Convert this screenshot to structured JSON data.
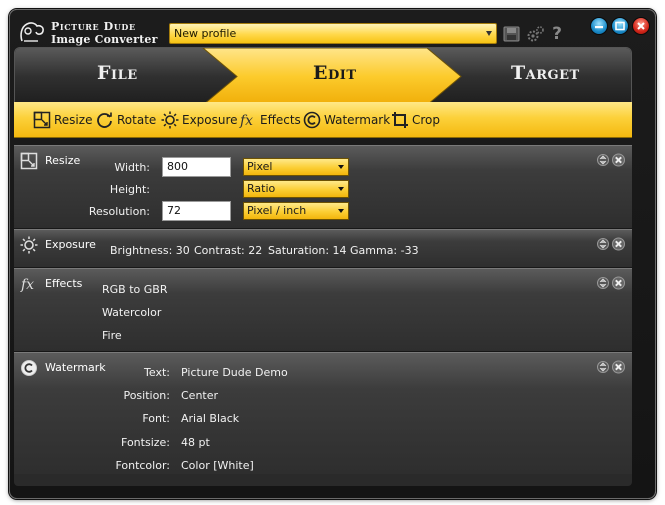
{
  "app": {
    "logo_line1": "Picture Dude",
    "logo_line2": "Image Converter",
    "profile": "New profile"
  },
  "steps": {
    "file": "File",
    "edit": "Edit",
    "target": "Target",
    "active": "edit"
  },
  "tools": [
    {
      "label": "Resize",
      "icon": "resize-icon"
    },
    {
      "label": "Rotate",
      "icon": "rotate-icon"
    },
    {
      "label": "Exposure",
      "icon": "exposure-icon"
    },
    {
      "label": "Effects",
      "icon": "effects-icon"
    },
    {
      "label": "Watermark",
      "icon": "watermark-icon"
    },
    {
      "label": "Crop",
      "icon": "crop-icon"
    }
  ],
  "resize": {
    "title": "Resize",
    "width_label": "Width:",
    "width_value": "800",
    "width_unit": "Pixel",
    "height_label": "Height:",
    "height_unit": "Ratio",
    "resolution_label": "Resolution:",
    "resolution_value": "72",
    "resolution_unit": "Pixel / inch"
  },
  "exposure": {
    "title": "Exposure",
    "brightness": "Brightness: 30",
    "contrast": "Contrast: 22",
    "saturation": "Saturation: 14",
    "gamma": "Gamma: -33"
  },
  "effects": {
    "title": "Effects",
    "items": [
      "RGB to GBR",
      "Watercolor",
      "Fire"
    ]
  },
  "watermark": {
    "title": "Watermark",
    "text_label": "Text:",
    "text_value": "Picture Dude Demo",
    "position_label": "Position:",
    "position_value": "Center",
    "font_label": "Font:",
    "font_value": "Arial Black",
    "fontsize_label": "Fontsize:",
    "fontsize_value": "48 pt",
    "fontcolor_label": "Fontcolor:",
    "fontcolor_value": "Color [White]"
  },
  "colors": {
    "accent": "#fcd13a",
    "background": "#1c1c1c",
    "panel": "#3c3c3c"
  }
}
